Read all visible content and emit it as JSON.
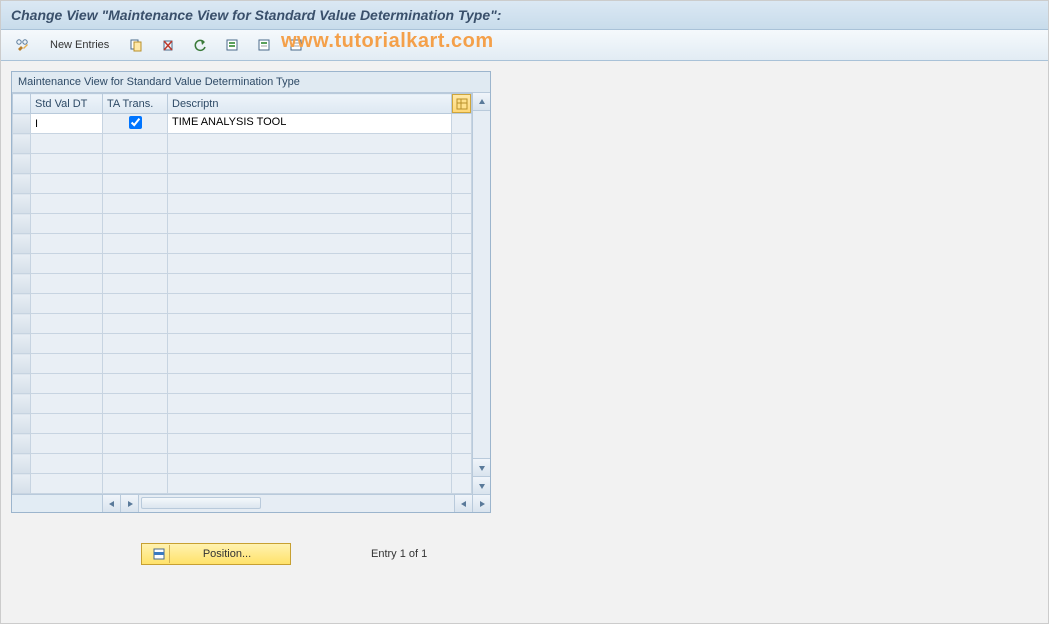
{
  "header": {
    "title": "Change View \"Maintenance View for Standard Value Determination Type\":"
  },
  "toolbar": {
    "new_entries": "New Entries"
  },
  "watermark": "www.tutorialkart.com",
  "grid": {
    "title": "Maintenance View for Standard Value Determination Type",
    "columns": {
      "std_val_dt": "Std Val DT",
      "ta_trans": "TA Trans.",
      "descriptn": "Descriptn"
    },
    "rows": [
      {
        "std_val_dt": "I",
        "ta_trans": true,
        "descriptn": "TIME ANALYSIS TOOL"
      }
    ]
  },
  "footer": {
    "position_label": "Position...",
    "entry_text": "Entry 1 of 1"
  }
}
